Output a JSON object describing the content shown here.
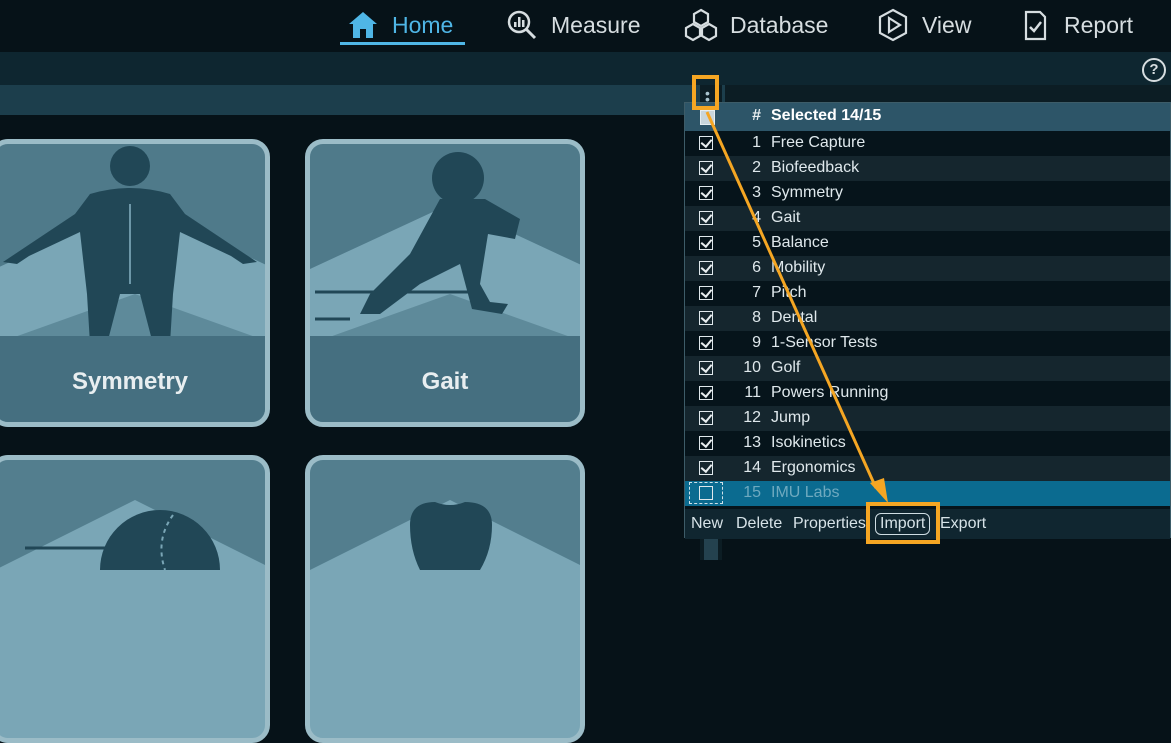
{
  "nav": {
    "items": [
      {
        "label": "Home",
        "icon": "home-icon"
      },
      {
        "label": "Measure",
        "icon": "measure-icon"
      },
      {
        "label": "Database",
        "icon": "database-icon"
      },
      {
        "label": "View",
        "icon": "view-icon"
      },
      {
        "label": "Report",
        "icon": "report-icon"
      }
    ],
    "active_color": "#4fb6e6"
  },
  "help_label": "?",
  "tiles": {
    "symmetry": "Symmetry",
    "gait": "Gait"
  },
  "panel": {
    "header_hash": "#",
    "header_title": "Selected 14/15",
    "rows": [
      {
        "num": "1",
        "name": "Free Capture",
        "checked": true
      },
      {
        "num": "2",
        "name": "Biofeedback",
        "checked": true
      },
      {
        "num": "3",
        "name": "Symmetry",
        "checked": true
      },
      {
        "num": "4",
        "name": "Gait",
        "checked": true
      },
      {
        "num": "5",
        "name": "Balance",
        "checked": true
      },
      {
        "num": "6",
        "name": "Mobility",
        "checked": true
      },
      {
        "num": "7",
        "name": "Pitch",
        "checked": true
      },
      {
        "num": "8",
        "name": "Dental",
        "checked": true
      },
      {
        "num": "9",
        "name": "1-Sensor Tests",
        "checked": true
      },
      {
        "num": "10",
        "name": "Golf",
        "checked": true
      },
      {
        "num": "11",
        "name": "Powers Running",
        "checked": true
      },
      {
        "num": "12",
        "name": "Jump",
        "checked": true
      },
      {
        "num": "13",
        "name": "Isokinetics",
        "checked": true
      },
      {
        "num": "14",
        "name": "Ergonomics",
        "checked": true
      },
      {
        "num": "15",
        "name": "IMU Labs",
        "checked": false
      }
    ],
    "footer": {
      "new": "New",
      "delete": "Delete",
      "properties": "Properties",
      "import": "Import",
      "export": "Export"
    }
  },
  "annotation_color": "#f5a623"
}
